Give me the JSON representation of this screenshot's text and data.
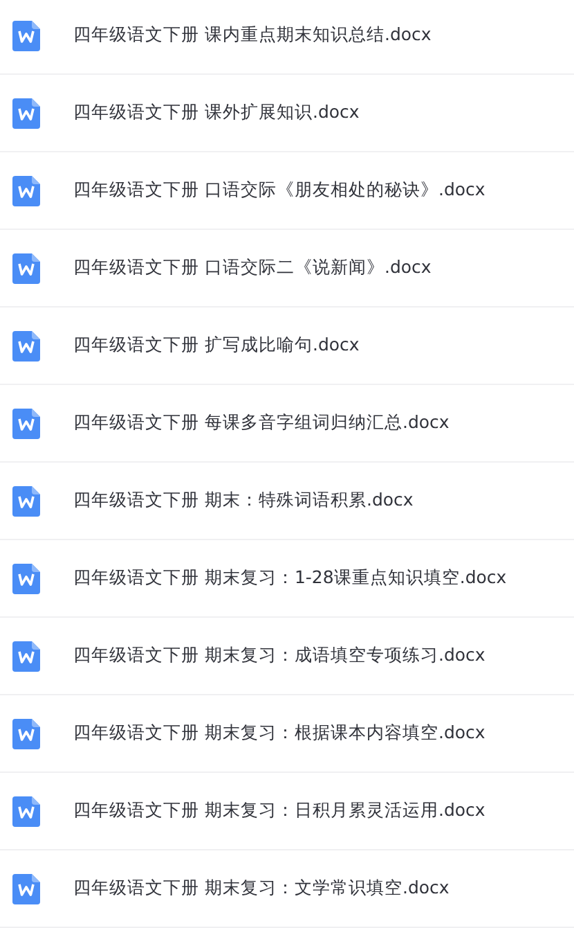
{
  "files": [
    {
      "name": "四年级语文下册 课内重点期末知识总结.docx"
    },
    {
      "name": "四年级语文下册 课外扩展知识.docx"
    },
    {
      "name": "四年级语文下册 口语交际《朋友相处的秘诀》.docx"
    },
    {
      "name": "四年级语文下册 口语交际二《说新闻》.docx"
    },
    {
      "name": "四年级语文下册 扩写成比喻句.docx"
    },
    {
      "name": "四年级语文下册 每课多音字组词归纳汇总.docx"
    },
    {
      "name": "四年级语文下册 期末：特殊词语积累.docx"
    },
    {
      "name": "四年级语文下册 期末复习：1-28课重点知识填空.docx"
    },
    {
      "name": "四年级语文下册 期末复习：成语填空专项练习.docx"
    },
    {
      "name": "四年级语文下册 期末复习：根据课本内容填空.docx"
    },
    {
      "name": "四年级语文下册 期末复习：日积月累灵活运用.docx"
    },
    {
      "name": "四年级语文下册 期末复习：文学常识填空.docx"
    }
  ]
}
